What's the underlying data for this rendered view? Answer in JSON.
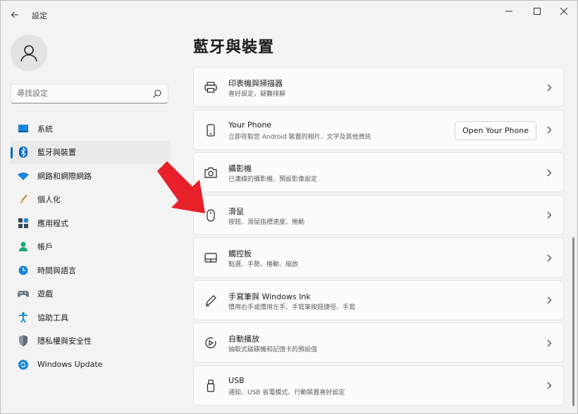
{
  "window": {
    "app_title": "設定",
    "controls": [
      "minimize-icon",
      "maximize-icon",
      "close-icon"
    ]
  },
  "sidebar": {
    "search_placeholder": "尋找設定",
    "items": [
      {
        "label": "系統",
        "icon": "display-icon",
        "active": false
      },
      {
        "label": "藍牙與裝置",
        "icon": "bluetooth-icon",
        "active": true
      },
      {
        "label": "網路和網際網路",
        "icon": "wifi-icon",
        "active": false
      },
      {
        "label": "個人化",
        "icon": "brush-icon",
        "active": false
      },
      {
        "label": "應用程式",
        "icon": "apps-icon",
        "active": false
      },
      {
        "label": "帳戶",
        "icon": "person-icon",
        "active": false
      },
      {
        "label": "時間與語言",
        "icon": "globe-clock-icon",
        "active": false
      },
      {
        "label": "遊戲",
        "icon": "gamepad-icon",
        "active": false
      },
      {
        "label": "協助工具",
        "icon": "accessibility-icon",
        "active": false
      },
      {
        "label": "隱私權與安全性",
        "icon": "shield-icon",
        "active": false
      },
      {
        "label": "Windows Update",
        "icon": "update-icon",
        "active": false
      }
    ]
  },
  "main": {
    "title": "藍牙與裝置",
    "cards": [
      {
        "title": "印表機與掃描器",
        "desc": "喜好設定，疑難排解",
        "icon": "printer-icon"
      },
      {
        "title": "Your Phone",
        "desc": "立即存取您 Android 裝置的相片、文字及其他資訊",
        "icon": "phone-icon",
        "button": "Open Your Phone"
      },
      {
        "title": "攝影機",
        "desc": "已連線的攝影機、預設影像設定",
        "icon": "camera-icon"
      },
      {
        "title": "滑鼠",
        "desc": "按鈕、滑鼠指標速度、捲動",
        "icon": "mouse-icon"
      },
      {
        "title": "觸控板",
        "desc": "點選、手勢、捲動、縮放",
        "icon": "touchpad-icon"
      },
      {
        "title": "手寫筆與 Windows Ink",
        "desc": "慣用右手或慣用左手、手寫筆按鈕捷徑、手寫",
        "icon": "pen-icon"
      },
      {
        "title": "自動播放",
        "desc": "抽取式磁碟機和記憶卡的預設值",
        "icon": "autoplay-icon"
      },
      {
        "title": "USB",
        "desc": "通知、USB 省電模式、行動裝置喜好設定",
        "icon": "usb-icon"
      }
    ]
  },
  "colors": {
    "accent": "#0067c0",
    "annotation_arrow": "#e8202a"
  }
}
